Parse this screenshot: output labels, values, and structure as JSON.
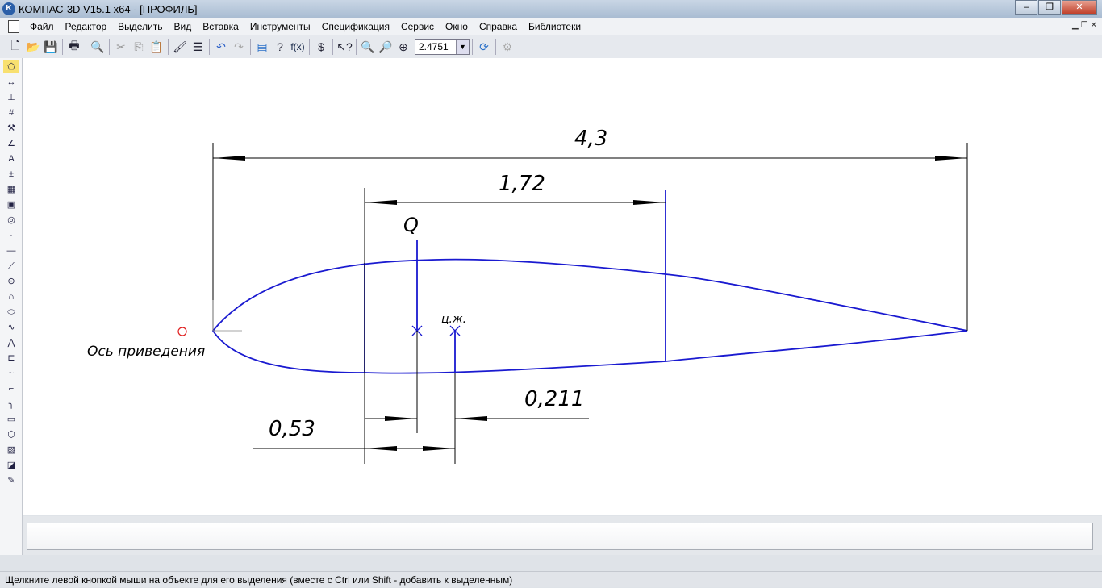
{
  "window": {
    "title": "КОМПАС-3D V15.1 x64 - [ПРОФИЛЬ]",
    "logo": "K",
    "controls": [
      "minimize",
      "maximize",
      "close"
    ]
  },
  "menu": [
    "Файл",
    "Редактор",
    "Выделить",
    "Вид",
    "Вставка",
    "Инструменты",
    "Спецификация",
    "Сервис",
    "Окно",
    "Справка",
    "Библиотеки"
  ],
  "toolbar": {
    "zoom_value": "2.4751",
    "fx_label": "f(x)"
  },
  "drawing": {
    "dim_total": "4,3",
    "dim_chord": "1,72",
    "label_q": "Q",
    "label_cg": "ц.ж.",
    "dim_left": "0,53",
    "dim_right": "0,211",
    "axis_label": "Ось приведения",
    "line_color": "#1a1ad0",
    "dim_color": "#000000",
    "marker_color": "#e02020"
  },
  "status": {
    "text": "Щелкните левой кнопкой мыши на объекте для его выделения (вместе с Ctrl или Shift - добавить к выделенным)"
  }
}
